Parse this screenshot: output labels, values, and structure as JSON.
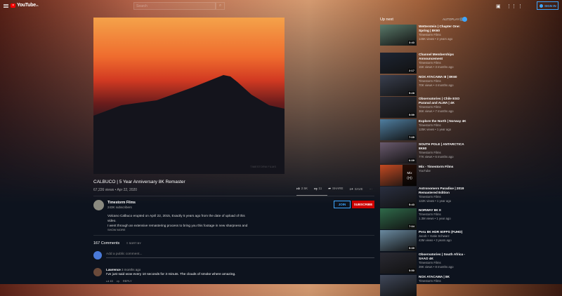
{
  "header": {
    "logo": "YouTube",
    "logo_sup": "CA",
    "search_placeholder": "Search",
    "sign_in": "SIGN IN"
  },
  "video": {
    "title": "CALBUCO | 5 Year Anniversary 8K Remaster",
    "views": "67,226 views",
    "date": "Apr 22, 2020",
    "likes": "2.5K",
    "dislikes": "11",
    "share": "SHARE",
    "save": "SAVE",
    "watermark": "TIMESTORM FILMS"
  },
  "channel": {
    "name": "Timestorm Films",
    "subscribers": "243K subscribers",
    "join": "JOIN",
    "subscribe": "SUBSCRIBE",
    "description": [
      "Volcano Calbuco erupted on April 22, 2015, Exactly 5 years ago from the date of upload of this",
      "video.",
      "I went through an extensive remastering process to bring you this footage in new sharpness and"
    ],
    "show_more": "SHOW MORE"
  },
  "comments": {
    "count": "167 Comments",
    "sort": "SORT BY",
    "placeholder": "Add a public comment...",
    "items": [
      {
        "author": "Lawrence",
        "time": "3 months ago",
        "text": "I've just said wow every 10 seconds for 3 minuts. The clouds of smoke where amazing.",
        "likes": "43",
        "reply": "REPLY"
      }
    ]
  },
  "sidebar": {
    "up_next": "Up next",
    "autoplay": "AUTOPLAY",
    "items": [
      {
        "title": "Wetterstein | Chapter One: Spring | 8K60",
        "channel": "Timestorm Films",
        "meta": "145K views • 2 years ago",
        "duration": "3:43",
        "color": "#5a7a6a"
      },
      {
        "title": "Channel Memberships Announcement",
        "channel": "Timestorm Films",
        "meta": "15K views • 3 months ago",
        "duration": "2:17",
        "color": "#1d2533"
      },
      {
        "title": "NOX ATACAMA III | 8K60",
        "channel": "Timestorm Films",
        "meta": "70K views • 4 months ago",
        "duration": "5:28",
        "color": "#3a4050"
      },
      {
        "title": "Observatories | Chile ESO Paranal and ALMA | 4K",
        "channel": "Timestorm Films",
        "meta": "36K views • 7 months ago",
        "duration": "5:59",
        "color": "#2a2c36"
      },
      {
        "title": "Explore the North | Norway 4K",
        "channel": "Timestorm Films",
        "meta": "125K views • 1 year ago",
        "duration": "7:05",
        "color": "#4f7ea0"
      },
      {
        "title": "SOUTH POLE | ANTARCTICA 8K60",
        "channel": "Timestorm Films",
        "meta": "77K views • 6 months ago",
        "duration": "6:09",
        "color": "#6a5a6e"
      },
      {
        "title": "Mix - Timestorm Films",
        "channel": "YouTube",
        "meta": "",
        "duration": "",
        "mix": "Mix",
        "color": "#c44a22"
      },
      {
        "title": "Astronomers Paradise | 2019 Remastered Edition",
        "channel": "Timestorm Films",
        "meta": "122K views • 1 year ago",
        "duration": "5:43",
        "color": "#2a2f40"
      },
      {
        "title": "NORWAY 8K II",
        "channel": "Timestorm Films",
        "meta": "1.3M views • 1 year ago",
        "duration": "7:04",
        "color": "#2f6a4a"
      },
      {
        "title": "Peru 8K HDR 60FPS (FUHD)",
        "channel": "Jacob + Katie Schwarz",
        "meta": "43M views • 3 years ago",
        "duration": "5:39",
        "color": "#6a8aa0"
      },
      {
        "title": "Observatories | South Africa - SAAO 4K",
        "channel": "Timestorm Films",
        "meta": "39K views • 8 months ago",
        "duration": "5:50",
        "color": "#2a2a33"
      },
      {
        "title": "NOX ATACAMA | 8K",
        "channel": "Timestorm Films",
        "meta": "",
        "duration": "",
        "color": "#40485a"
      }
    ]
  }
}
